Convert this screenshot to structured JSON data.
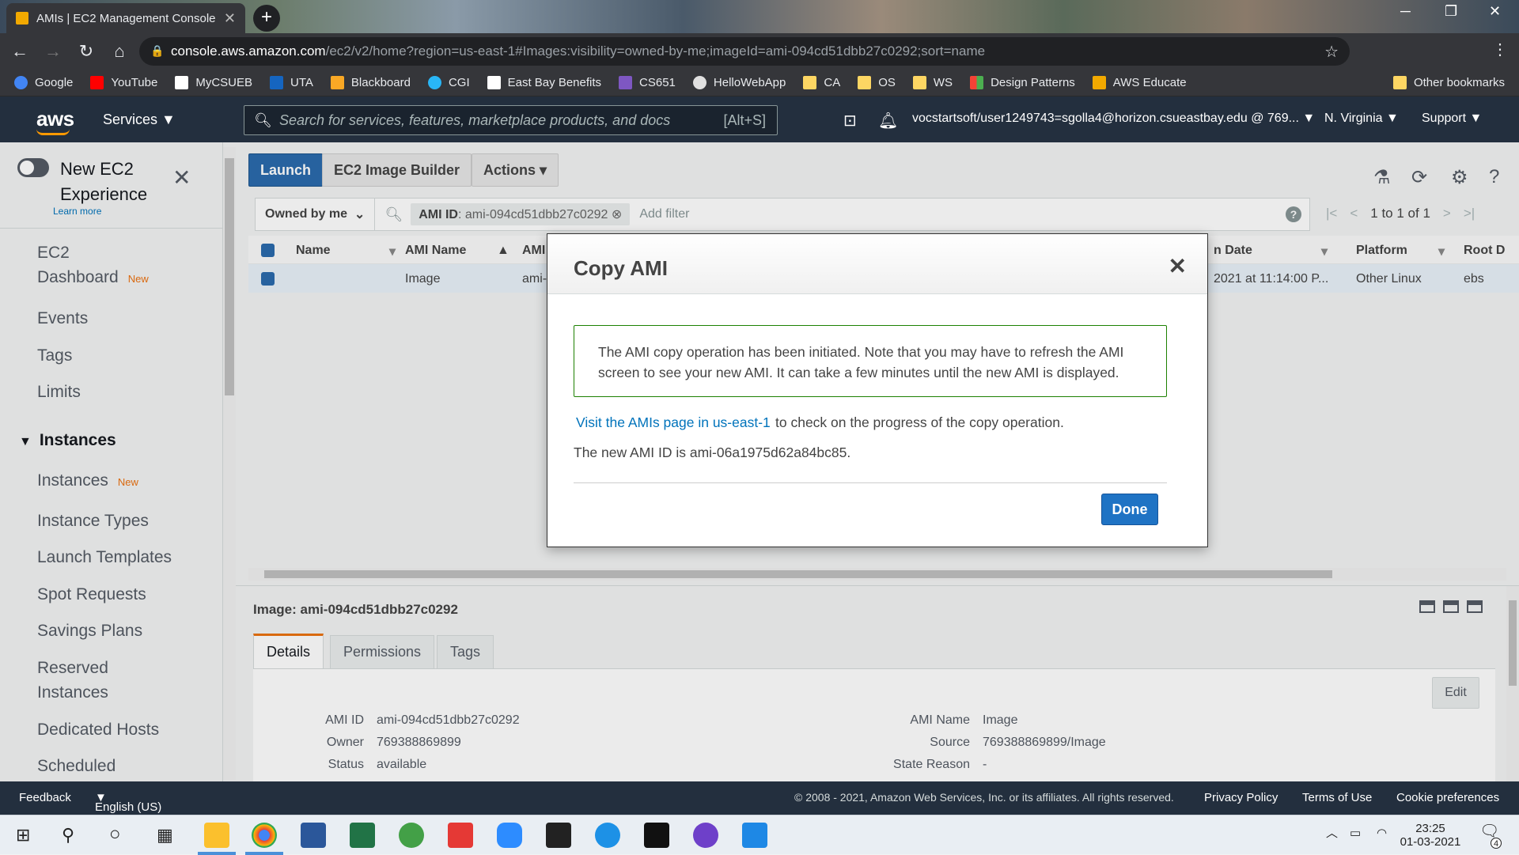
{
  "browser": {
    "tab_title": "AMIs | EC2 Management Console",
    "url_host": "console.aws.amazon.com",
    "url_path": "/ec2/v2/home?region=us-east-1#Images:visibility=owned-by-me;imageId=ami-094cd51dbb27c0292;sort=name",
    "bookmarks": [
      "Google",
      "YouTube",
      "MyCSUEB",
      "UTA",
      "Blackboard",
      "CGI",
      "East Bay Benefits",
      "CS651",
      "HelloWebApp",
      "CA",
      "OS",
      "WS",
      "Design Patterns",
      "AWS Educate"
    ],
    "other_bookmarks": "Other bookmarks"
  },
  "aws_nav": {
    "logo": "aws",
    "services": "Services",
    "search_placeholder": "Search for services, features, marketplace products, and docs",
    "search_shortcut": "[Alt+S]",
    "account": "vocstartsoft/user1249743=sgolla4@horizon.csueastbay.edu @ 769...",
    "region": "N. Virginia",
    "support": "Support"
  },
  "sidebar": {
    "new_experience": "New EC2 Experience",
    "learn_more": "Learn more",
    "ec2_dashboard_1": "EC2",
    "ec2_dashboard_2": "Dashboard",
    "new_badge": "New",
    "events": "Events",
    "tags": "Tags",
    "limits": "Limits",
    "instances_group": "Instances",
    "instances": "Instances",
    "instance_types": "Instance Types",
    "launch_templates": "Launch Templates",
    "spot_requests": "Spot Requests",
    "savings_plans": "Savings Plans",
    "reserved_1": "Reserved",
    "reserved_2": "Instances",
    "dedicated_hosts": "Dedicated Hosts",
    "scheduled": "Scheduled"
  },
  "toolbar": {
    "launch": "Launch",
    "image_builder": "EC2 Image Builder",
    "actions": "Actions"
  },
  "filter": {
    "owned": "Owned by me",
    "chip_key": "AMI ID",
    "chip_value": ": ami-094cd51dbb27c0292",
    "add_filter": "Add filter",
    "pager": "1 to 1 of 1"
  },
  "table": {
    "headers": [
      "Name",
      "AMI Name",
      "AMI",
      "n Date",
      "Platform",
      "Root D"
    ],
    "row": {
      "ami_name": "Image",
      "ami_id": "ami-",
      "date": "2021 at 11:14:00 P...",
      "platform": "Other Linux",
      "root": "ebs"
    }
  },
  "details": {
    "title": "Image: ami-094cd51dbb27c0292",
    "tabs": [
      "Details",
      "Permissions",
      "Tags"
    ],
    "edit": "Edit",
    "fields": {
      "ami_id_label": "AMI ID",
      "ami_id": "ami-094cd51dbb27c0292",
      "owner_label": "Owner",
      "owner": "769388869899",
      "status_label": "Status",
      "status": "available",
      "ami_name_label": "AMI Name",
      "ami_name": "Image",
      "source_label": "Source",
      "source": "769388869899/Image",
      "state_reason_label": "State Reason",
      "state_reason": "-"
    }
  },
  "modal": {
    "title": "Copy AMI",
    "success": "The AMI copy operation has been initiated. Note that you may have to refresh the AMI screen to see your new AMI. It can take a few minutes until the new AMI is displayed.",
    "link": "Visit the AMIs page in us-east-1",
    "link_suffix": "to check on the progress of the copy operation.",
    "new_id": "The new AMI ID is ami-06a1975d62a84bc85.",
    "done": "Done"
  },
  "footer": {
    "feedback": "Feedback",
    "language": "English (US)",
    "copyright": "© 2008 - 2021, Amazon Web Services, Inc. or its affiliates. All rights reserved.",
    "privacy": "Privacy Policy",
    "terms": "Terms of Use",
    "cookies": "Cookie preferences"
  },
  "taskbar": {
    "time": "23:25",
    "date": "01-03-2021",
    "notifications": "4"
  }
}
